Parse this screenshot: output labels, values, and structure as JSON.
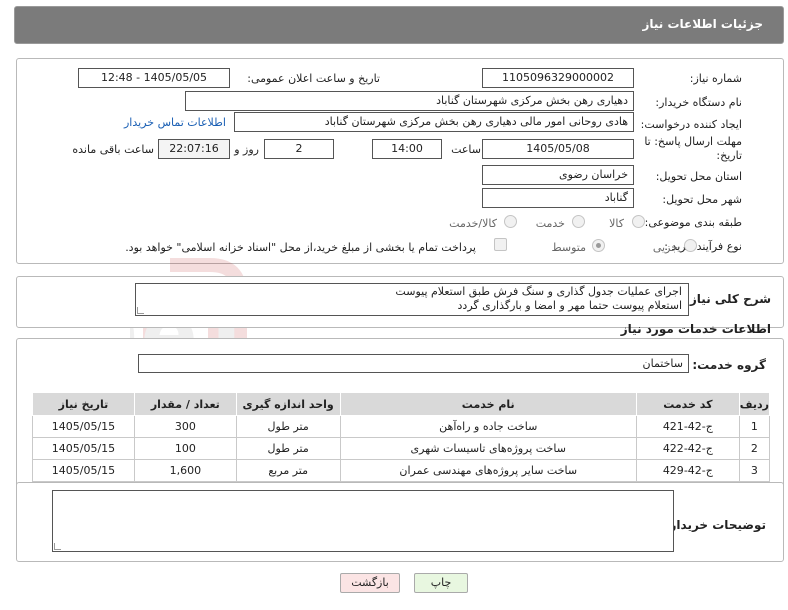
{
  "header": {
    "title": "جزئیات اطلاعات نیاز"
  },
  "form": {
    "need_number_label": "شماره نیاز:",
    "need_number": "1105096329000002",
    "announce_label": "تاریخ و ساعت اعلان عمومی:",
    "announce_value": "1405/05/05 - 12:48",
    "buyer_org_label": "نام دستگاه خریدار:",
    "buyer_org": "دهیاری رهن بخش مرکزی شهرستان گناباد",
    "creator_label": "ایجاد کننده درخواست:",
    "creator": "هادی روحانی امور مالی دهیاری رهن بخش مرکزی شهرستان گناباد",
    "contact_link": "اطلاعات تماس خریدار",
    "deadline_label_line1": "مهلت ارسال پاسخ: تا",
    "deadline_label_line2": "تاریخ:",
    "deadline_date": "1405/05/08",
    "time_label": "ساعت",
    "deadline_time": "14:00",
    "days_value": "2",
    "days_label": "روز و",
    "remaining_time": "22:07:16",
    "remaining_label": "ساعت باقی مانده",
    "province_label": "استان محل تحویل:",
    "province": "خراسان رضوی",
    "city_label": "شهر محل تحویل:",
    "city": "گناباد",
    "category_label": "طبقه بندی موضوعی:",
    "category_options": [
      "کالا",
      "خدمت",
      "کالا/خدمت"
    ],
    "purchase_type_label": "نوع فرآیند خرید :",
    "purchase_options": [
      "جزیی",
      "متوسط"
    ],
    "payment_note": "پرداخت تمام یا بخشی از مبلغ خرید،از محل \"اسناد خزانه اسلامی\" خواهد بود."
  },
  "description": {
    "label": "شرح کلی نیاز:",
    "line1": "اجرای عملیات جدول گذاری و سنگ فرش طبق استعلام پیوست",
    "line2": "استعلام پیوست حتما مهر و امضا و بارگذاری گردد"
  },
  "services": {
    "section_title": "اطلاعات خدمات مورد نیاز",
    "group_label": "گروه خدمت:",
    "group_value": "ساختمان",
    "columns": [
      "ردیف",
      "کد خدمت",
      "نام خدمت",
      "واحد اندازه گیری",
      "تعداد / مقدار",
      "تاریخ نیاز"
    ],
    "rows": [
      {
        "row": "1",
        "code": "ج-42-421",
        "name": "ساخت جاده و راه‌آهن",
        "unit": "متر طول",
        "qty": "300",
        "date": "1405/05/15"
      },
      {
        "row": "2",
        "code": "ج-42-422",
        "name": "ساخت پروژه‌های تاسیسات شهری",
        "unit": "متر طول",
        "qty": "100",
        "date": "1405/05/15"
      },
      {
        "row": "3",
        "code": "ج-42-429",
        "name": "ساخت سایر پروژه‌های مهندسی عمران",
        "unit": "متر مربع",
        "qty": "1,600",
        "date": "1405/05/15"
      }
    ]
  },
  "buyer_notes": {
    "label": "توضیحات خریدار:",
    "value": ""
  },
  "buttons": {
    "print": "چاپ",
    "back": "بازگشت"
  },
  "watermark": {
    "text": "AriaTender.neT"
  },
  "colors": {
    "header_bg": "#7b7b7b",
    "link": "#1a5fb4",
    "print_bg": "#e8f7e0",
    "back_bg": "#fbe4e4",
    "table_header": "#d9d9d9"
  }
}
